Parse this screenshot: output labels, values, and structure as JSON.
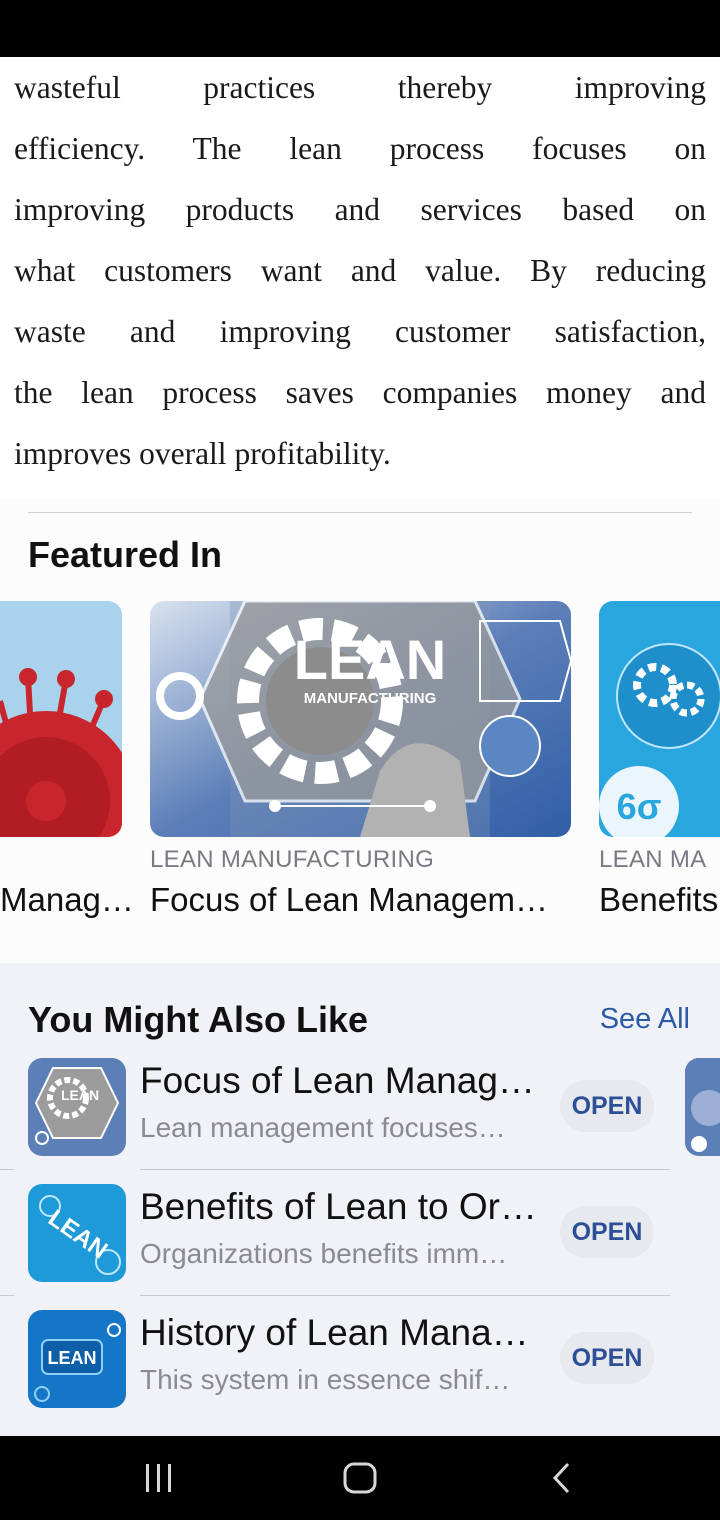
{
  "article": {
    "lines": [
      "wasteful practices thereby improving",
      "efficiency. The lean process focuses on",
      "improving products and services based on",
      "what customers want and value. By reducing",
      "waste and improving customer satisfaction,",
      "the lean process saves companies money and",
      "improves overall profitability."
    ]
  },
  "featured": {
    "heading": "Featured In",
    "cards": [
      {
        "category": "",
        "title": "Manag…"
      },
      {
        "category": "LEAN MANUFACTURING",
        "title": "Focus of Lean Managem…",
        "image_text": "LEAN",
        "image_subtext": "MANUFACTURING"
      },
      {
        "category": "LEAN MA",
        "title": "Benefits"
      }
    ]
  },
  "also": {
    "heading": "You Might Also Like",
    "see_all": "See All",
    "items": [
      {
        "title": "Focus of Lean Manag…",
        "subtitle": "Lean management focuses…",
        "action": "OPEN",
        "icon_text": "LEAN"
      },
      {
        "title": "Benefits of Lean to Or…",
        "subtitle": "Organizations benefits imm…",
        "action": "OPEN",
        "icon_text": "LEAN"
      },
      {
        "title": "History of Lean Mana…",
        "subtitle": "This system in essence shif…",
        "action": "OPEN",
        "icon_text": "LEAN"
      }
    ]
  },
  "colors": {
    "accent": "#2c5aa6",
    "muted": "#7a7a82",
    "section_bg": "#f1f2f7"
  }
}
